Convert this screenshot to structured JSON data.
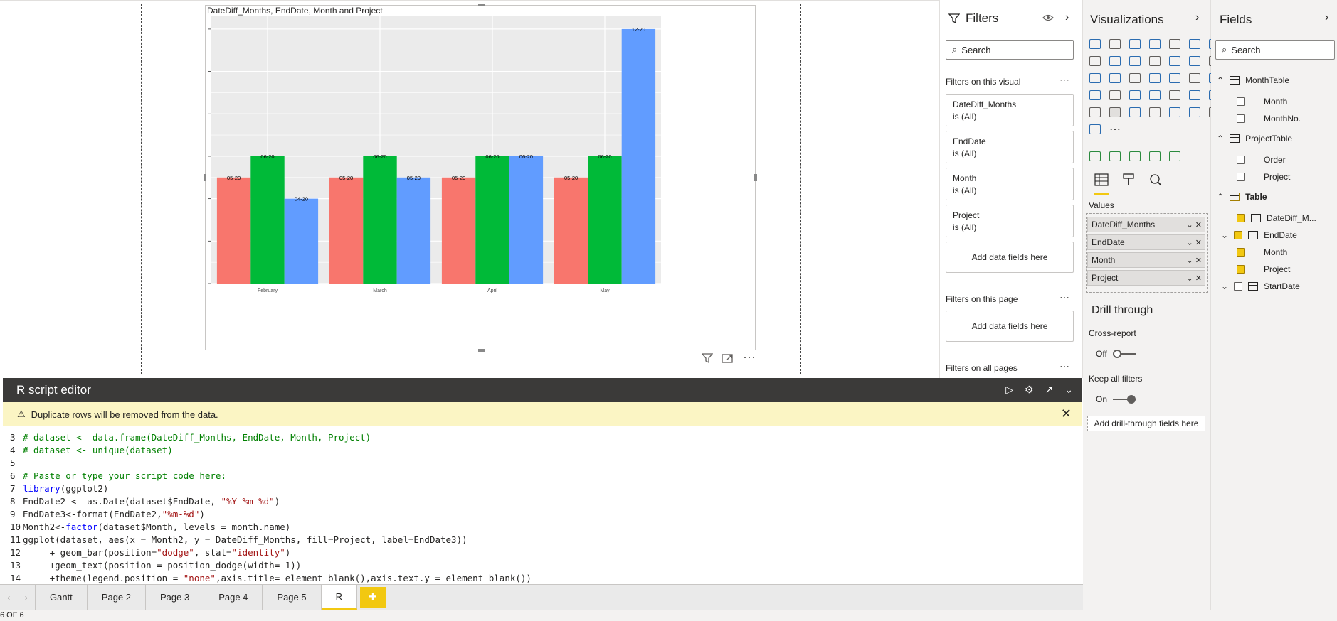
{
  "visual": {
    "title": "DateDiff_Months, EndDate, Month and Project",
    "toolbar": {
      "filter_icon": "filter-icon",
      "focus_icon": "focus-mode-icon",
      "more": "⋯"
    }
  },
  "chart_data": {
    "type": "bar",
    "categories": [
      "February",
      "March",
      "April",
      "May"
    ],
    "series": [
      {
        "color": "#f8766d",
        "values": [
          5,
          5,
          5,
          5
        ],
        "labels": [
          "05-20",
          "05-20",
          "05-20",
          "05-20"
        ]
      },
      {
        "color": "#00ba38",
        "values": [
          6,
          6,
          6,
          6
        ],
        "labels": [
          "06-20",
          "06-20",
          "06-20",
          "06-20"
        ]
      },
      {
        "color": "#619cff",
        "values": [
          4,
          5,
          6,
          12
        ],
        "labels": [
          "04-20",
          "05-20",
          "06-20",
          "12-20"
        ]
      }
    ],
    "ylim": [
      0,
      12.6
    ],
    "grid": true,
    "legend": "none",
    "xlabel": "",
    "ylabel": ""
  },
  "filters": {
    "title": "Filters",
    "search_placeholder": "Search",
    "on_visual_label": "Filters on this visual",
    "cards": [
      {
        "name": "DateDiff_Months",
        "state": "is (All)"
      },
      {
        "name": "EndDate",
        "state": "is (All)"
      },
      {
        "name": "Month",
        "state": "is (All)"
      },
      {
        "name": "Project",
        "state": "is (All)"
      }
    ],
    "add_fields": "Add data fields here",
    "on_page_label": "Filters on this page",
    "on_all_pages_label": "Filters on all pages",
    "more": "⋯"
  },
  "visualizations": {
    "title": "Visualizations",
    "values_label": "Values",
    "wells": [
      "DateDiff_Months",
      "EndDate",
      "Month",
      "Project"
    ],
    "drill_title": "Drill through",
    "cross_report_label": "Cross-report",
    "cross_report_state": "Off",
    "keep_filters_label": "Keep all filters",
    "keep_filters_state": "On",
    "drill_add": "Add drill-through fields here"
  },
  "fields": {
    "title": "Fields",
    "search_placeholder": "Search",
    "tables": [
      {
        "name": "MonthTable",
        "fields": [
          {
            "name": "Month",
            "checked": false
          },
          {
            "name": "MonthNo.",
            "checked": false
          }
        ]
      },
      {
        "name": "ProjectTable",
        "fields": [
          {
            "name": "Order",
            "checked": false
          },
          {
            "name": "Project",
            "checked": false
          }
        ]
      },
      {
        "name": "Table",
        "fields": [
          {
            "name": "DateDiff_M...",
            "checked": true
          },
          {
            "name": "EndDate",
            "checked": true
          },
          {
            "name": "Month",
            "checked": true
          },
          {
            "name": "Project",
            "checked": true
          },
          {
            "name": "StartDate",
            "checked": false
          }
        ]
      }
    ]
  },
  "editor": {
    "title": "R script editor",
    "warning": "Duplicate rows will be removed from the data.",
    "lines": [
      {
        "n": "3",
        "parts": [
          {
            "c": "cm",
            "t": "# dataset <- data.frame(DateDiff_Months, EndDate, Month, Project)"
          }
        ]
      },
      {
        "n": "4",
        "parts": [
          {
            "c": "cm",
            "t": "# dataset <- unique(dataset)"
          }
        ]
      },
      {
        "n": "5",
        "parts": []
      },
      {
        "n": "6",
        "parts": [
          {
            "c": "cm",
            "t": "# Paste or type your script code here:"
          }
        ]
      },
      {
        "n": "7",
        "parts": [
          {
            "c": "kw",
            "t": "library"
          },
          {
            "c": "tx",
            "t": "(ggplot2)"
          }
        ]
      },
      {
        "n": "8",
        "parts": [
          {
            "c": "tx",
            "t": "EndDate2 <- as.Date(dataset$EndDate, "
          },
          {
            "c": "st",
            "t": "\"%Y-%m-%d\""
          },
          {
            "c": "tx",
            "t": ")"
          }
        ]
      },
      {
        "n": "9",
        "parts": [
          {
            "c": "tx",
            "t": "EndDate3<-format(EndDate2,"
          },
          {
            "c": "st",
            "t": "\"%m-%d\""
          },
          {
            "c": "tx",
            "t": ")"
          }
        ]
      },
      {
        "n": "10",
        "parts": [
          {
            "c": "tx",
            "t": "Month2<-"
          },
          {
            "c": "kw",
            "t": "factor"
          },
          {
            "c": "tx",
            "t": "(dataset$Month, levels = month.name)"
          }
        ]
      },
      {
        "n": "11",
        "parts": [
          {
            "c": "tx",
            "t": "ggplot(dataset, aes(x = Month2, y = DateDiff_Months, fill=Project, label=EndDate3))"
          }
        ]
      },
      {
        "n": "12",
        "parts": [
          {
            "c": "tx",
            "t": "     + geom_bar(position="
          },
          {
            "c": "st",
            "t": "\"dodge\""
          },
          {
            "c": "tx",
            "t": ", stat="
          },
          {
            "c": "st",
            "t": "\"identity\""
          },
          {
            "c": "tx",
            "t": ")"
          }
        ]
      },
      {
        "n": "13",
        "parts": [
          {
            "c": "tx",
            "t": "     +geom_text(position = position_dodge(width= 1))"
          }
        ]
      },
      {
        "n": "14",
        "parts": [
          {
            "c": "tx",
            "t": "     +theme(legend.position = "
          },
          {
            "c": "st",
            "t": "\"none\""
          },
          {
            "c": "tx",
            "t": ",axis.title= element_blank(),axis.text.y = element_blank())"
          }
        ]
      }
    ]
  },
  "tabs": {
    "items": [
      "Gantt",
      "Page 2",
      "Page 3",
      "Page 4",
      "Page 5",
      "R"
    ],
    "active": "R",
    "add": "+"
  },
  "status": {
    "page_info": "6 OF 6"
  }
}
